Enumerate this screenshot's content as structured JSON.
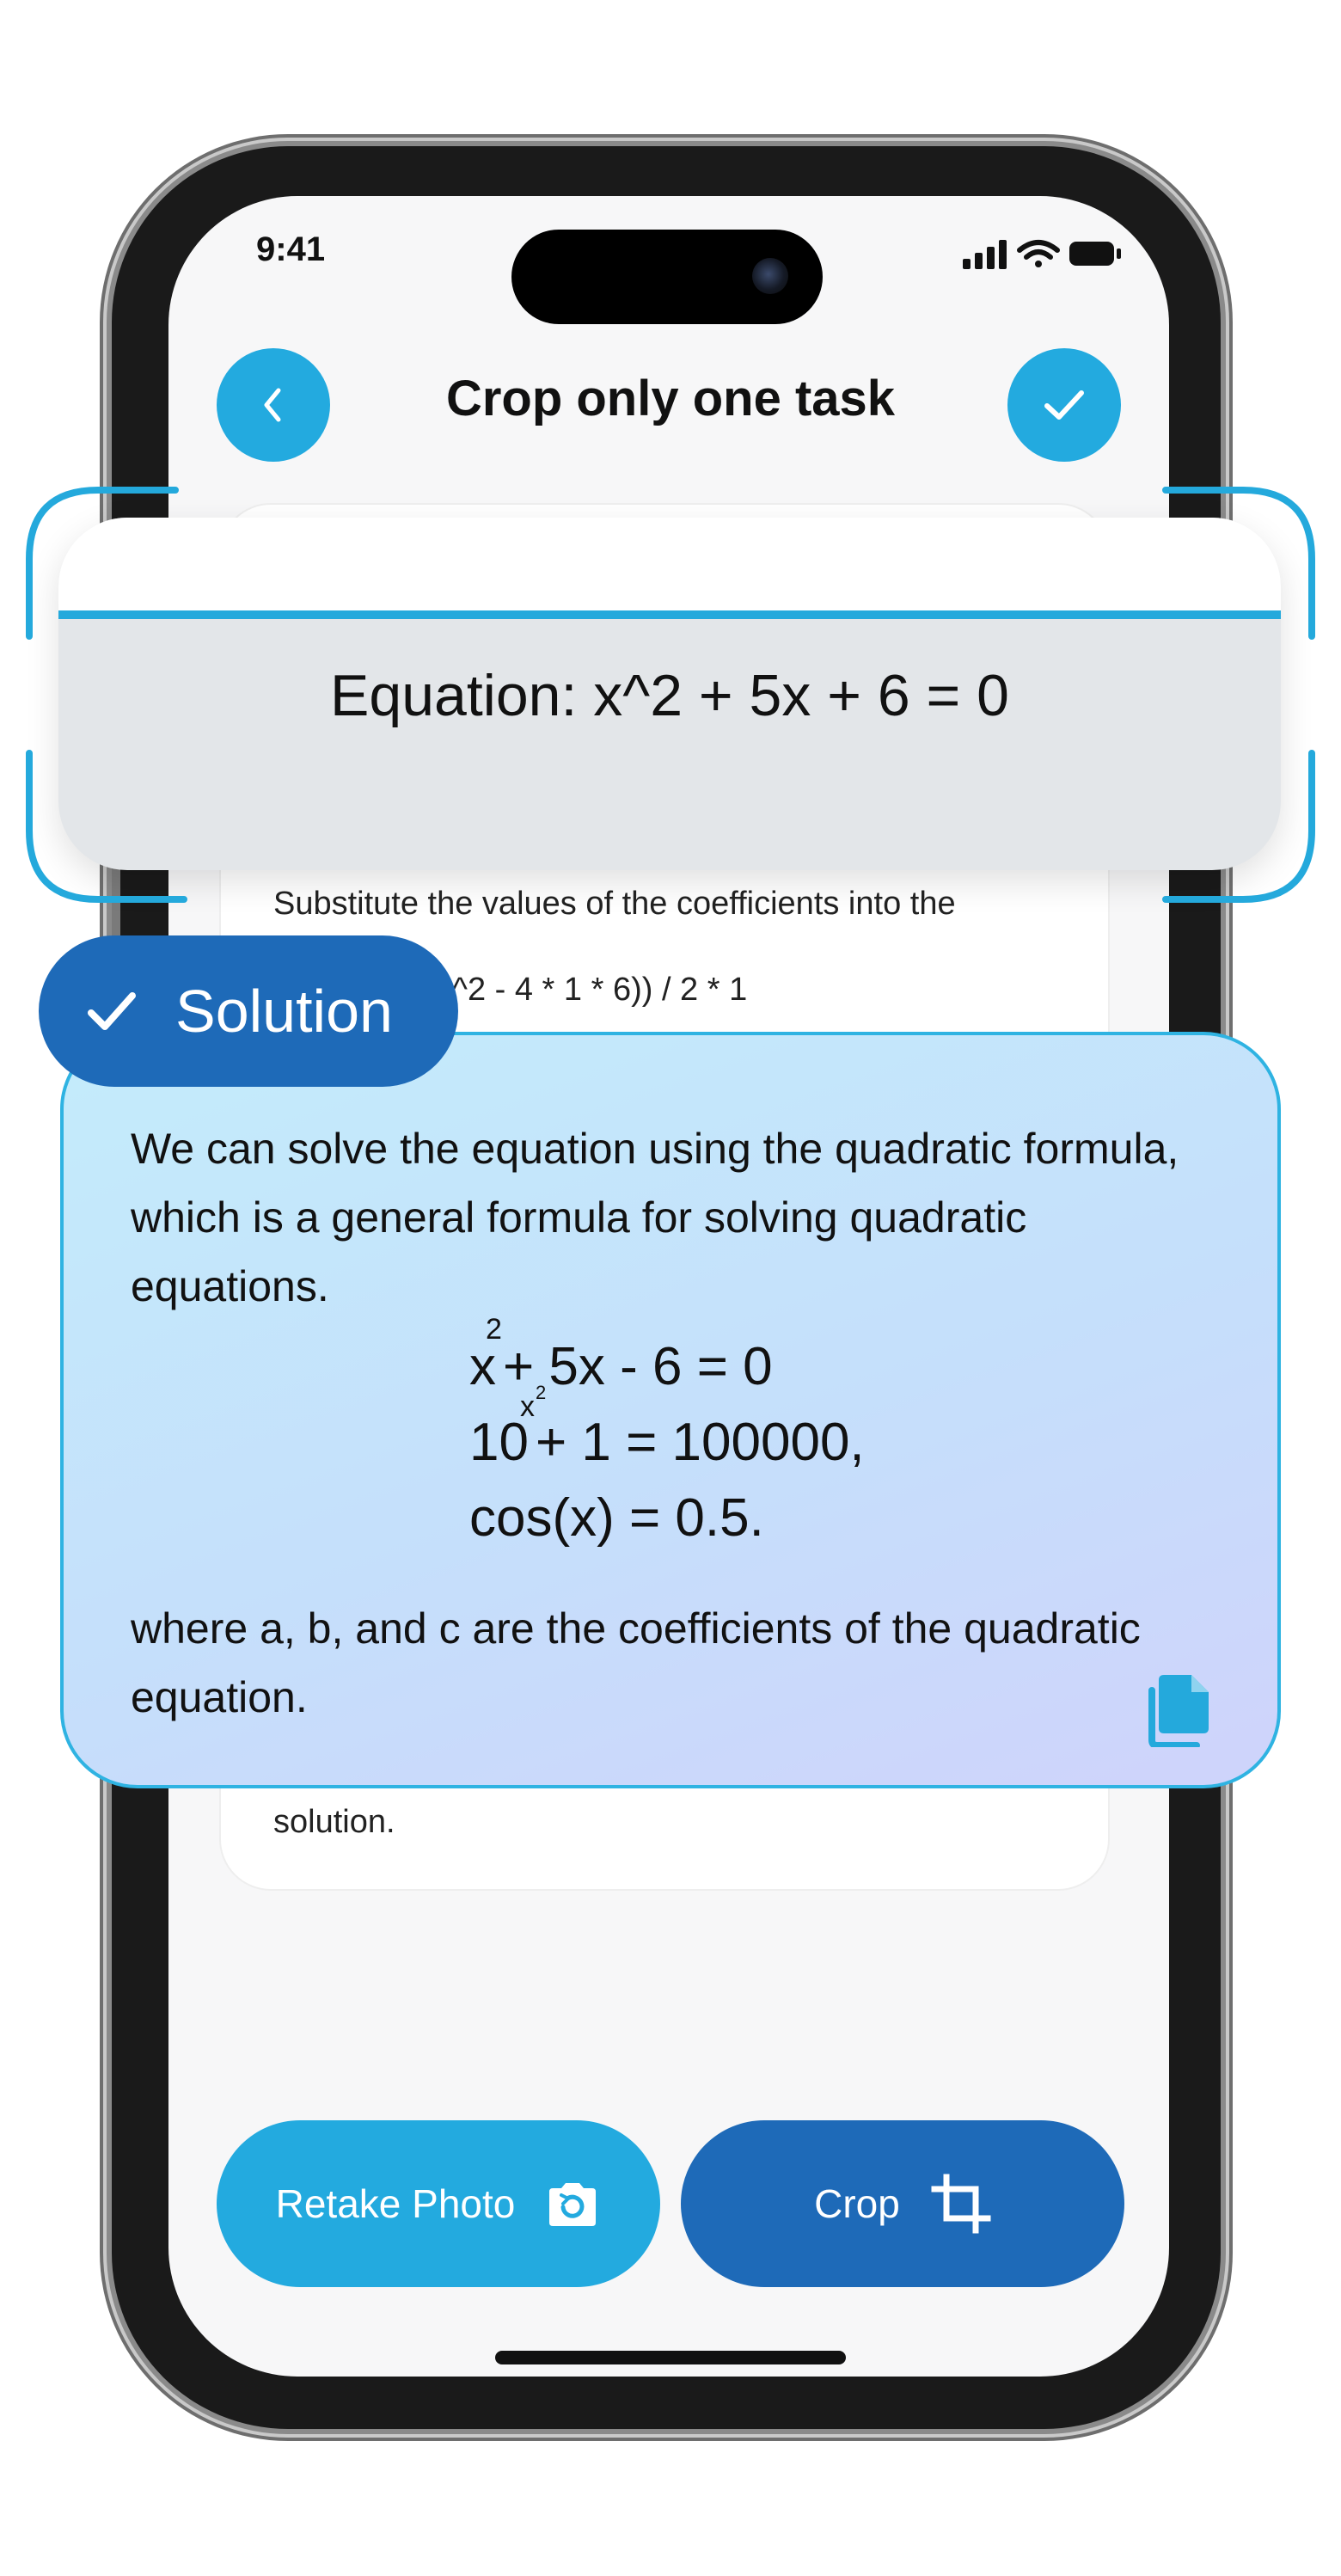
{
  "status_bar": {
    "time": "9:41"
  },
  "header": {
    "title": "Crop only one task",
    "back_icon": "chevron-left-icon",
    "confirm_icon": "checkmark-icon"
  },
  "content": {
    "line_substitute": "Substitute the values of the coefficients into the",
    "line_formula_fragment": "5^2 - 4 * 1 * 6)) / 2 * 1",
    "line_solution": "solution."
  },
  "equation_crop": {
    "text": "Equation: x^2 + 5x + 6 = 0"
  },
  "solution": {
    "badge_label": "Solution",
    "intro": "We can solve the equation using the quadratic formula, which is a general formula for solving quadratic equations.",
    "formulas": {
      "f1_base": "x",
      "f1_exp": "2",
      "f1_rest": "+ 5x - 6 = 0",
      "f2_base": "10",
      "f2_exp": "x",
      "f2_exp_exp": "2",
      "f2_rest": "+ 1 = 100000,",
      "f3": "cos(x) = 0.5."
    },
    "outro": "where a, b, and c are the coefficients of the quadratic equation.",
    "copy_icon": "copy-icon"
  },
  "buttons": {
    "retake": "Retake Photo",
    "crop": "Crop"
  },
  "colors": {
    "accent": "#23aadf",
    "primary_dark": "#1e6ab8",
    "background": "#f7f7f8"
  }
}
